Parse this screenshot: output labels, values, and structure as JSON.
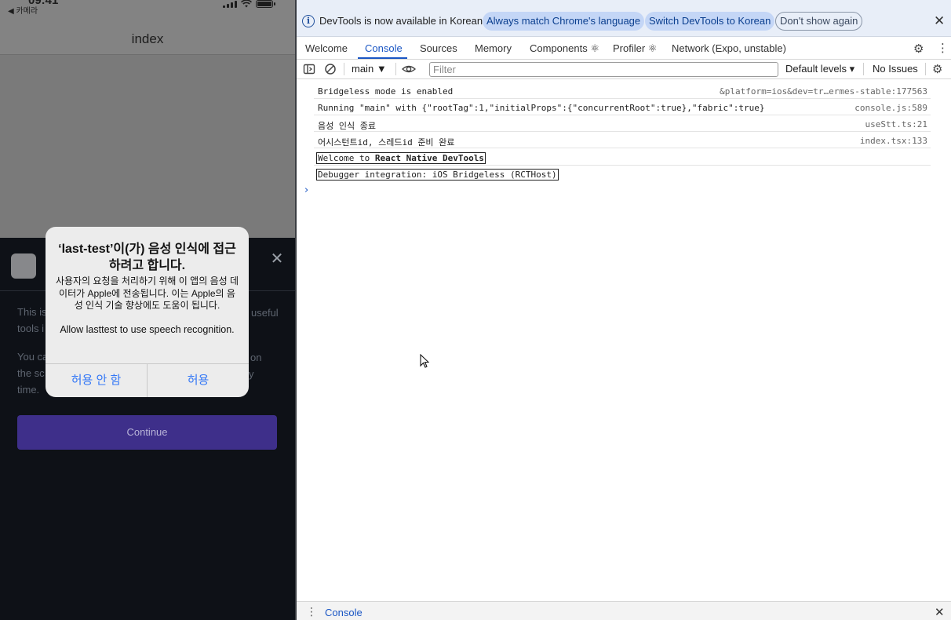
{
  "simulator": {
    "status": {
      "time": "09:41",
      "back_label": "◀ 카메라"
    },
    "nav_title": "index",
    "sheet": {
      "line1_visible": "This is",
      "line1_tail": "useful",
      "line2_visible": "tools i",
      "line3_visible": "You ca",
      "line3_tail": "on",
      "line4_visible": "the sc",
      "line4_tail": "y",
      "line5_visible": "time.",
      "continue_label": "Continue",
      "close_glyph": "✕"
    },
    "alert": {
      "title": "‘last-test’이(가) 음성 인식에 접근하려고 합니다.",
      "message_ko": "사용자의 요청을 처리하기 위해 이 앱의 음성 데이터가 Apple에 전송됩니다. 이는 Apple의 음성 인식 기술 향상에도 도움이 됩니다.",
      "message_en": "Allow lasttest to use speech recognition.",
      "deny_label": "허용 안 함",
      "allow_label": "허용"
    }
  },
  "devtools": {
    "infobar": {
      "text": "DevTools is now available in Korean!",
      "btn_match": "Always match Chrome's language",
      "btn_switch": "Switch DevTools to Korean",
      "btn_dismiss": "Don't show again"
    },
    "tabs": [
      {
        "label": "Welcome"
      },
      {
        "label": "Console"
      },
      {
        "label": "Sources"
      },
      {
        "label": "Memory"
      },
      {
        "label": "Components ⚛"
      },
      {
        "label": "Profiler ⚛"
      },
      {
        "label": "Network (Expo, unstable)"
      }
    ],
    "active_tab": "Console",
    "toolbar": {
      "context": "main",
      "filter_placeholder": "Filter",
      "levels": "Default levels",
      "issues": "No Issues"
    },
    "console_rows": [
      {
        "message": "Bridgeless mode is enabled",
        "source": "&platform=ios&dev=tr…ermes-stable:177563"
      },
      {
        "message": "Running \"main\" with {\"rootTag\":1,\"initialProps\":{\"concurrentRoot\":true},\"fabric\":true}",
        "source": "console.js:589"
      },
      {
        "message": "음성 인식 종료",
        "source": "useStt.ts:21"
      },
      {
        "message": "어시스턴트id, 스레드id 준비 완료",
        "source": "index.tsx:133"
      },
      {
        "message_prefix": "Welcome to ",
        "message_bold": "React Native DevTools",
        "source": ""
      },
      {
        "message": "Debugger integration: iOS Bridgeless (RCTHost)",
        "source": ""
      }
    ],
    "prompt_glyph": "›",
    "drawer_tab": "Console"
  },
  "colors": {
    "accent": "#1a56c4",
    "continue_button": "#3e2f8a",
    "alert_button": "#3478f6"
  }
}
